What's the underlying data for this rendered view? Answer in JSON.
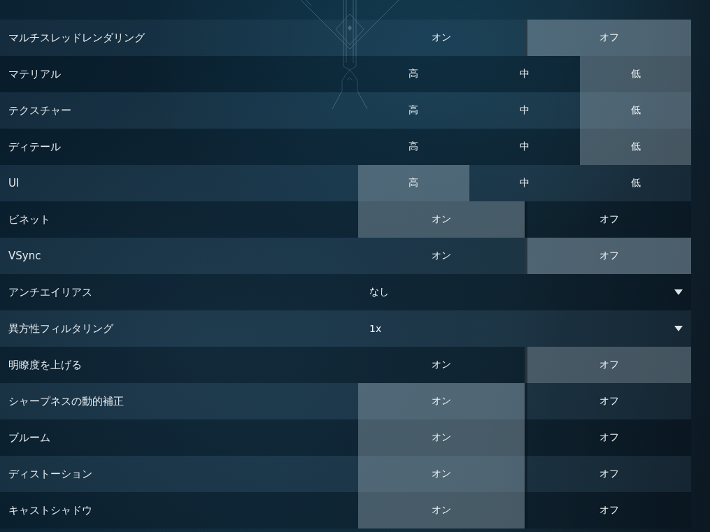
{
  "settings": [
    {
      "label": "マルチスレッドレンダリング",
      "kind": "toggle",
      "options": [
        {
          "label": "オン",
          "selected": false
        },
        {
          "label": "オフ",
          "selected": true
        }
      ]
    },
    {
      "label": "マテリアル",
      "kind": "levels",
      "options": [
        {
          "label": "高",
          "selected": false
        },
        {
          "label": "中",
          "selected": false
        },
        {
          "label": "低",
          "selected": true
        }
      ]
    },
    {
      "label": "テクスチャー",
      "kind": "levels",
      "options": [
        {
          "label": "高",
          "selected": false
        },
        {
          "label": "中",
          "selected": false
        },
        {
          "label": "低",
          "selected": true
        }
      ]
    },
    {
      "label": "ディテール",
      "kind": "levels",
      "options": [
        {
          "label": "高",
          "selected": false
        },
        {
          "label": "中",
          "selected": false
        },
        {
          "label": "低",
          "selected": true
        }
      ]
    },
    {
      "label": "UI",
      "kind": "levels",
      "options": [
        {
          "label": "高",
          "selected": true
        },
        {
          "label": "中",
          "selected": false
        },
        {
          "label": "低",
          "selected": false
        }
      ]
    },
    {
      "label": "ビネット",
      "kind": "toggle",
      "options": [
        {
          "label": "オン",
          "selected": true
        },
        {
          "label": "オフ",
          "selected": false
        }
      ]
    },
    {
      "label": "VSync",
      "kind": "toggle",
      "options": [
        {
          "label": "オン",
          "selected": false
        },
        {
          "label": "オフ",
          "selected": true
        }
      ]
    },
    {
      "label": "アンチエイリアス",
      "kind": "dropdown",
      "value": "なし"
    },
    {
      "label": "異方性フィルタリング",
      "kind": "dropdown",
      "value": "1x"
    },
    {
      "label": "明瞭度を上げる",
      "kind": "toggle",
      "options": [
        {
          "label": "オン",
          "selected": false
        },
        {
          "label": "オフ",
          "selected": true
        }
      ]
    },
    {
      "label": "シャープネスの動的補正",
      "kind": "toggle",
      "options": [
        {
          "label": "オン",
          "selected": true
        },
        {
          "label": "オフ",
          "selected": false
        }
      ]
    },
    {
      "label": "ブルーム",
      "kind": "toggle",
      "options": [
        {
          "label": "オン",
          "selected": true
        },
        {
          "label": "オフ",
          "selected": false
        }
      ]
    },
    {
      "label": "ディストーション",
      "kind": "toggle",
      "options": [
        {
          "label": "オン",
          "selected": true
        },
        {
          "label": "オフ",
          "selected": false
        }
      ]
    },
    {
      "label": "キャストシャドウ",
      "kind": "toggle",
      "options": [
        {
          "label": "オン",
          "selected": true
        },
        {
          "label": "オフ",
          "selected": false
        }
      ]
    }
  ]
}
